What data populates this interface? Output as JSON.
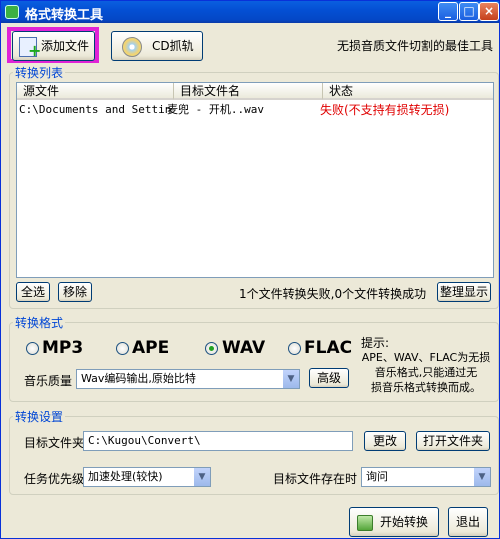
{
  "window": {
    "title": "格式转换工具",
    "min": "_",
    "max": "□",
    "close": "×"
  },
  "toolbar": {
    "add_file": "添加文件",
    "cd_rip": "CD抓轨",
    "tagline": "无损音质文件切割的最佳工具"
  },
  "list": {
    "group_label": "转换列表",
    "columns": [
      "源文件",
      "目标文件名",
      "状态"
    ],
    "rows": [
      {
        "source": "C:\\Documents and Settin...",
        "target": "麦兜 - 开机..wav",
        "status": "失败(不支持有损转无损)"
      }
    ],
    "select_all": "全选",
    "remove": "移除",
    "summary": "1个文件转换失败,0个文件转换成功",
    "tidy": "整理显示"
  },
  "format": {
    "group_label": "转换格式",
    "options": [
      "MP3",
      "APE",
      "WAV",
      "FLAC"
    ],
    "selected": "WAV",
    "quality_label": "音乐质量",
    "quality_value": "Wav编码输出,原始比特",
    "advanced": "高级",
    "hint_title": "提示:",
    "hint_lines": [
      "APE、WAV、FLAC为无损",
      "音乐格式,只能通过无",
      "损音乐格式转换而成。"
    ]
  },
  "settings": {
    "group_label": "转换设置",
    "folder_label": "目标文件夹",
    "folder_value": "C:\\Kugou\\Convert\\",
    "change": "更改",
    "open_folder": "打开文件夹",
    "priority_label": "任务优先级",
    "priority_value": "加速处理(较快)",
    "exists_label": "目标文件存在时",
    "exists_value": "询问"
  },
  "footer": {
    "start": "开始转换",
    "exit": "退出"
  }
}
